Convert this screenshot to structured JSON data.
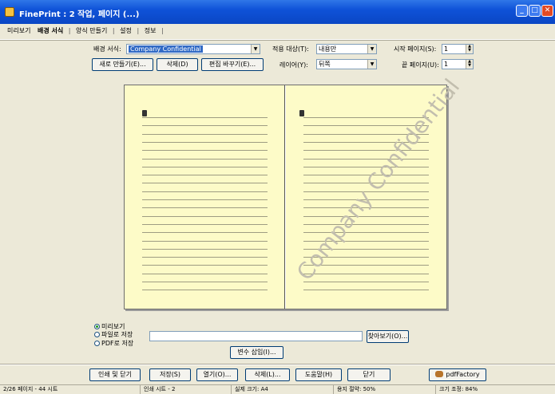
{
  "window": {
    "title": "FinePrint : 2 작업, 페이지 (...)",
    "minimize_icon": "minimize-icon",
    "maximize_icon": "maximize-icon",
    "close_icon": "close-icon"
  },
  "tabs": [
    "미리보기",
    "배경 서식",
    "양식 만들기",
    "설정",
    "정보"
  ],
  "form": {
    "stationery_label": "배경 서식:",
    "stationery_value": "Company Confidential",
    "apply_to_label": "적용 대상(T):",
    "apply_to_value": "내용만",
    "start_page_label": "시작 페이지(S):",
    "start_page_value": "1",
    "new_button": "새로 만들기(E)...",
    "delete_button": "삭제(D)",
    "edit_button": "편집 바꾸기(E)...",
    "layer_label": "레이어(Y):",
    "layer_value": "뒤쪽",
    "pages_label": "끝 페이지(U):",
    "pages_value": "1"
  },
  "preview": {
    "watermark": "Company Confidential"
  },
  "radios": {
    "option1": "미리보기",
    "option2": "파일로 저장",
    "option3": "PDF로 저장"
  },
  "browse_button": "찾아보기(O)...",
  "variables_button": "변수 삽입(I)...",
  "actions": {
    "print": "인쇄 및 닫기",
    "save": "저장(S)",
    "open": "열기(O)...",
    "delete": "삭제(L)...",
    "help": "도움말(H)",
    "close": "닫기",
    "pdffactory": "pdfFactory"
  },
  "status": {
    "pages": "2/26 페이지 - 44 시트",
    "sheets": "인쇄 시트 - 2",
    "paper_size": "실제 크기: A4",
    "ink_saved": "용지 절약: 50%",
    "zoom": "크기 조정: 84%"
  },
  "colors": {
    "titlebar": "#0f52d8",
    "page_bg": "#fdfbc8",
    "dialog_bg": "#ece9d8"
  }
}
